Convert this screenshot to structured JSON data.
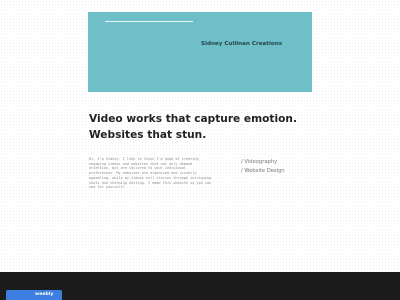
{
  "hero": {
    "brand": "Sidney Cullinan Creations",
    "color": "#6fbfc8"
  },
  "headline": {
    "line1": "Video works that capture emotion.",
    "line2": "Websites that stun."
  },
  "intro": {
    "text": "Hi, I'm Sidney. I like to think I'm good at creating engaging videos and websites that not only demand attention, but are tailored to your individual preferences. My websites are organized and visually appealing, while my videos tell stories through intriguing shots and charming editing. I made this website so you can see for yourself!"
  },
  "services": [
    "/ Videography",
    "/ Website Design"
  ],
  "footer": {
    "badge_label": "weebly",
    "badge_color": "#3d7fe0"
  }
}
